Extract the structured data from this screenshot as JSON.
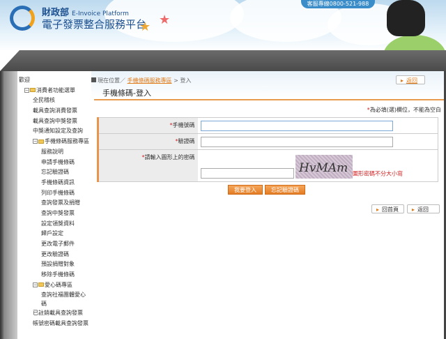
{
  "header": {
    "org": "財政部",
    "platform_en": "E-Invoice Platform",
    "title": "電子發票整合服務平台",
    "hotline": "客服專線0800-521-988"
  },
  "sidebar": {
    "welcome": "歡迎",
    "consumer_menu": "消費者功能選單",
    "consumer_items": [
      "全民稽核",
      "載具查詢消費發票",
      "載具查詢中獎發票",
      "中獎通知設定及查詢"
    ],
    "mobile_zone": "手機條碼服務專區",
    "mobile_items": [
      "服務說明",
      "申請手機條碼",
      "忘記驗證碼",
      "手機條碼資訊",
      "列印手機條碼",
      "查詢發票及捐贈",
      "查詢中獎發票",
      "設定領獎資料",
      "歸戶設定",
      "更改電子郵件",
      "更改驗證碼",
      "預設捐贈對象",
      "移除手機條碼"
    ],
    "love_zone": "愛心碼專區",
    "love_items": [
      "查詢社福團體愛心碼"
    ],
    "bottom_items": [
      "已註銷載具查詢發票",
      "帳號密碼載具查詢發票"
    ]
  },
  "breadcrumb": {
    "prefix": "現在位置／",
    "link": "手機條碼服務專區",
    "sep": " > ",
    "current": "登入"
  },
  "back_label": "返回",
  "home_label": "回首頁",
  "page_title": "手機條碼-登入",
  "required_note": "為必填(選)欄位，不能為空白",
  "form": {
    "phone_label": "手機號碼",
    "phone_value": "",
    "code_label": "驗證碼",
    "code_value": "",
    "captcha_label": "請輸入圖形上的密碼",
    "captcha_value": "",
    "captcha_image_text": "HvMAm",
    "captcha_hint": "圖形密碼不分大小寫"
  },
  "buttons": {
    "login": "我要登入",
    "forgot": "忘記驗證碼"
  }
}
